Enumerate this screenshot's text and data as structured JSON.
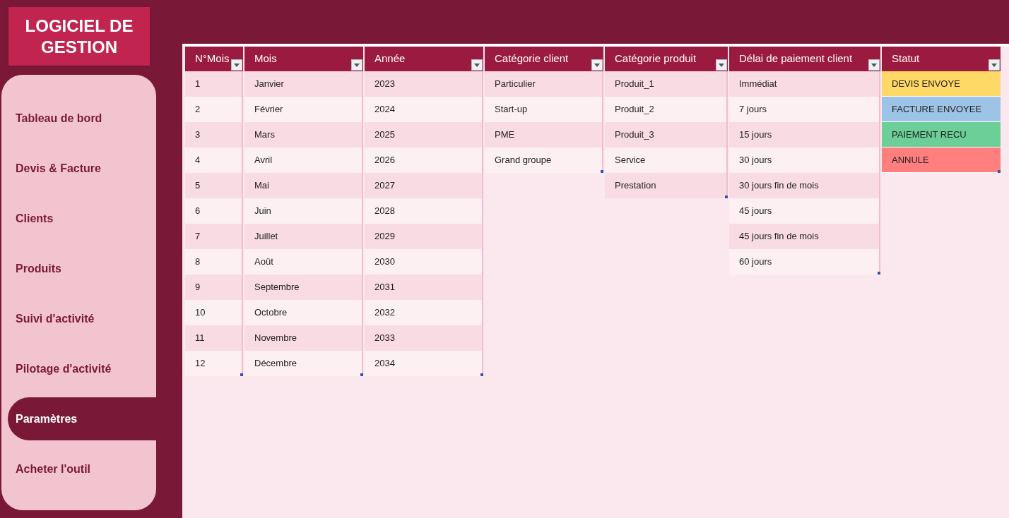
{
  "logo": {
    "title": "LOGICIEL  DE GESTION"
  },
  "sidebar": {
    "items": [
      {
        "label": "Tableau de bord",
        "selected": false
      },
      {
        "label": "Devis & Facture",
        "selected": false
      },
      {
        "label": "Clients",
        "selected": false
      },
      {
        "label": "Produits",
        "selected": false
      },
      {
        "label": "Suivi d'activité",
        "selected": false
      },
      {
        "label": "Pilotage d'activité",
        "selected": false
      },
      {
        "label": "Paramètres",
        "selected": true
      },
      {
        "label": "Acheter l'outil",
        "selected": false
      }
    ]
  },
  "tables": [
    {
      "kind": "plain",
      "header": "N°Mois",
      "cells": [
        "1",
        "2",
        "3",
        "4",
        "5",
        "6",
        "7",
        "8",
        "9",
        "10",
        "11",
        "12"
      ]
    },
    {
      "kind": "plain",
      "header": "Mois",
      "cells": [
        "Janvier",
        "Février",
        "Mars",
        "Avril",
        "Mai",
        "Juin",
        "Juillet",
        "Août",
        "Septembre",
        "Octobre",
        "Novembre",
        "Décembre"
      ]
    },
    {
      "kind": "plain",
      "header": "Année",
      "cells": [
        "2023",
        "2024",
        "2025",
        "2026",
        "2027",
        "2028",
        "2029",
        "2030",
        "2031",
        "2032",
        "2033",
        "2034"
      ]
    },
    {
      "kind": "plain",
      "header": "Catégorie client",
      "cells": [
        "Particulier",
        "Start-up",
        "PME",
        "Grand groupe"
      ]
    },
    {
      "kind": "plain",
      "header": "Catégorie produit",
      "cells": [
        "Produit_1",
        "Produit_2",
        "Produit_3",
        "Service",
        "Prestation"
      ]
    },
    {
      "kind": "plain",
      "header": "Délai de paiement client",
      "cells": [
        "Immédiat",
        "7 jours",
        "15 jours",
        "30 jours",
        "30 jours fin de mois",
        "45 jours",
        "45 jours fin de mois",
        "60 jours"
      ]
    },
    {
      "kind": "status",
      "header": "Statut",
      "cells": [
        {
          "text": "DEVIS ENVOYE",
          "color": "#ffd966"
        },
        {
          "text": "FACTURE ENVOYEE",
          "color": "#9dc3e6"
        },
        {
          "text": "PAIEMENT RECU",
          "color": "#6bcf97"
        },
        {
          "text": "ANNULE",
          "color": "#ff7f7f"
        }
      ]
    }
  ]
}
